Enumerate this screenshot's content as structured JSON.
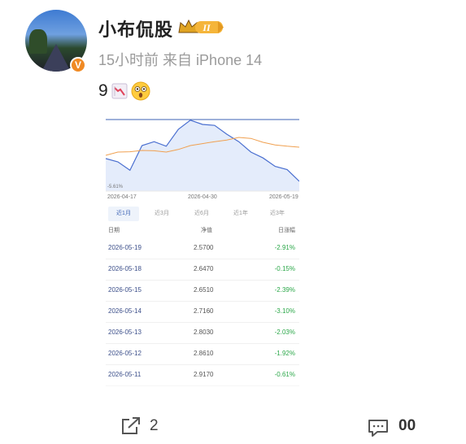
{
  "post": {
    "username": "小布侃股",
    "level_badge": "II",
    "time": "15小时前",
    "source": "来自 iPhone 14",
    "text": "9",
    "emojis": [
      "chart-decreasing-icon",
      "astonished-face-icon"
    ]
  },
  "fund_card": {
    "chart_data": {
      "type": "line",
      "x_ticks": [
        "2026-04-17",
        "2026-04-30",
        "2026-05-19"
      ],
      "y_label_visible": "-5.61%",
      "series": [
        {
          "color": "#4a6fd0",
          "values": [
            -2.0,
            -3.0,
            -5.6,
            2.0,
            3.2,
            1.8,
            7.0,
            9.8,
            8.5,
            8.2,
            5.5,
            3.2,
            0.0,
            -1.8,
            -4.4,
            -5.4,
            -9.0
          ]
        },
        {
          "color": "#f0a050",
          "values": [
            -1.0,
            0.0,
            0.1,
            0.5,
            0.4,
            0.0,
            0.8,
            2.0,
            2.6,
            3.2,
            3.7,
            4.5,
            4.2,
            3.0,
            2.2,
            1.8,
            1.5
          ]
        }
      ]
    },
    "tabs": [
      "近1月",
      "近3月",
      "近6月",
      "近1年",
      "近3年"
    ],
    "active_tab": 0,
    "headers": {
      "date": "日期",
      "nav": "净值",
      "change": "日涨幅"
    },
    "rows": [
      {
        "date": "2026-05-19",
        "nav": "2.5700",
        "change": "-2.91%"
      },
      {
        "date": "2026-05-18",
        "nav": "2.6470",
        "change": "-0.15%"
      },
      {
        "date": "2026-05-15",
        "nav": "2.6510",
        "change": "-2.39%"
      },
      {
        "date": "2026-05-14",
        "nav": "2.7160",
        "change": "-3.10%"
      },
      {
        "date": "2026-05-13",
        "nav": "2.8030",
        "change": "-2.03%"
      },
      {
        "date": "2026-05-12",
        "nav": "2.8610",
        "change": "-1.92%"
      },
      {
        "date": "2026-05-11",
        "nav": "2.9170",
        "change": "-0.61%"
      }
    ]
  },
  "actions": {
    "share_count": "2",
    "comment_count": "00"
  }
}
